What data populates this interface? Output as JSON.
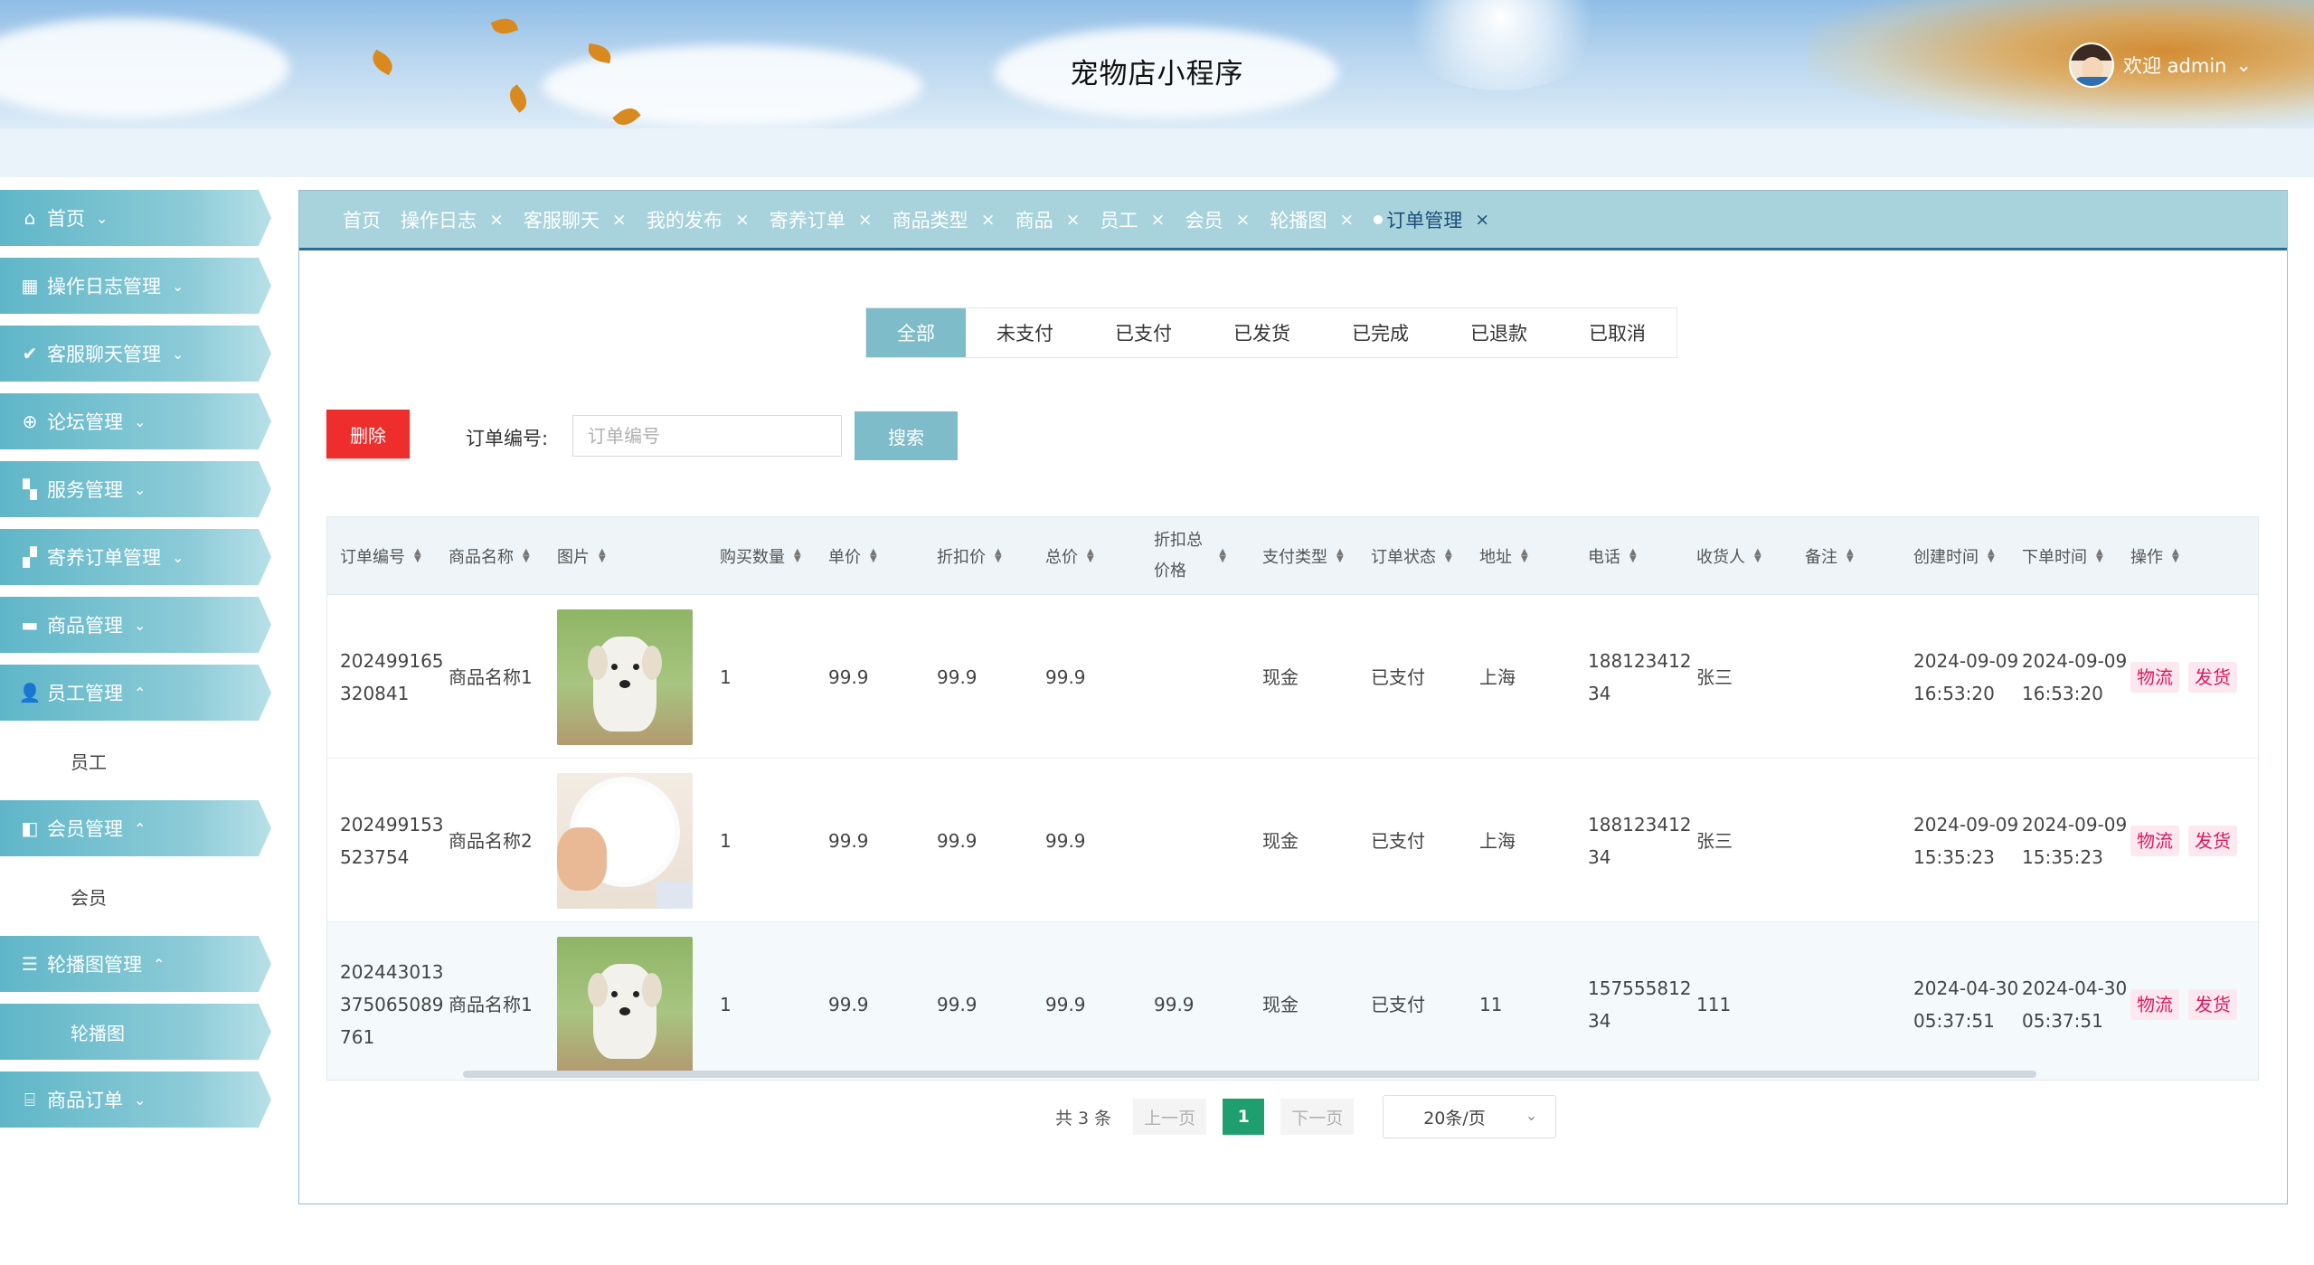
{
  "app": {
    "title": "宠物店小程序",
    "welcome": "欢迎 admin"
  },
  "sidebar": {
    "items": [
      {
        "label": "首页",
        "icon": "home-icon",
        "glyph": "⌂",
        "chev": "⌄"
      },
      {
        "label": "操作日志管理",
        "icon": "grid-icon",
        "glyph": "▦",
        "chev": "⌄"
      },
      {
        "label": "客服聊天管理",
        "icon": "check-icon",
        "glyph": "✔",
        "chev": "⌄"
      },
      {
        "label": "论坛管理",
        "icon": "plus-circle-icon",
        "glyph": "⊕",
        "chev": "⌄"
      },
      {
        "label": "服务管理",
        "icon": "tiles-icon",
        "glyph": "▚",
        "chev": "⌄"
      },
      {
        "label": "寄养订单管理",
        "icon": "blocks-icon",
        "glyph": "▞",
        "chev": "⌄"
      },
      {
        "label": "商品管理",
        "icon": "card-icon",
        "glyph": "▬",
        "chev": "⌄"
      },
      {
        "label": "员工管理",
        "icon": "user-icon",
        "glyph": "👤",
        "chev": "⌃",
        "sub": "员工"
      },
      {
        "label": "会员管理",
        "icon": "panel-icon",
        "glyph": "◧",
        "chev": "⌃",
        "sub": "会员"
      },
      {
        "label": "轮播图管理",
        "icon": "list-icon",
        "glyph": "☰",
        "chev": "⌃",
        "sub": "轮播图",
        "sub_active": true
      },
      {
        "label": "商品订单",
        "icon": "briefcase-icon",
        "glyph": "⌸",
        "chev": "⌄"
      }
    ]
  },
  "tabs": [
    "首页",
    "操作日志",
    "客服聊天",
    "我的发布",
    "寄养订单",
    "商品类型",
    "商品",
    "员工",
    "会员",
    "轮播图",
    "订单管理"
  ],
  "tab_close": "×",
  "status_tabs": [
    "全部",
    "未支付",
    "已支付",
    "已发货",
    "已完成",
    "已退款",
    "已取消"
  ],
  "toolbar": {
    "delete_label": "删除",
    "search_label": "订单编号:",
    "search_placeholder": "订单编号",
    "search_button": "搜索"
  },
  "table": {
    "columns": [
      "订单编号",
      "商品名称",
      "图片",
      "购买数量",
      "单价",
      "折扣价",
      "总价",
      "折扣总价格",
      "支付类型",
      "订单状态",
      "地址",
      "电话",
      "收货人",
      "备注",
      "创建时间",
      "下单时间",
      "操作"
    ],
    "rows": [
      {
        "order_no": "202499165320841",
        "name": "商品名称1",
        "image": "white-puppy-on-deck",
        "qty": "1",
        "price": "99.9",
        "discount": "99.9",
        "total": "99.9",
        "discount_total": "",
        "pay_type": "现金",
        "status": "已支付",
        "address": "上海",
        "phone": "18812341234",
        "receiver": "张三",
        "remark": "",
        "created": "2024-09-09 16:53:20",
        "ordered": "2024-09-09 16:53:20",
        "action1": "物流",
        "action2": "发货"
      },
      {
        "order_no": "202499153523754",
        "name": "商品名称2",
        "image": "fluffy-white-dog",
        "qty": "1",
        "price": "99.9",
        "discount": "99.9",
        "total": "99.9",
        "discount_total": "",
        "pay_type": "现金",
        "status": "已支付",
        "address": "上海",
        "phone": "18812341234",
        "receiver": "张三",
        "remark": "",
        "created": "2024-09-09 15:35:23",
        "ordered": "2024-09-09 15:35:23",
        "action1": "物流",
        "action2": "发货"
      },
      {
        "order_no": "202443013375065089761",
        "name": "商品名称1",
        "image": "white-puppy-on-deck",
        "qty": "1",
        "price": "99.9",
        "discount": "99.9",
        "total": "99.9",
        "discount_total": "99.9",
        "pay_type": "现金",
        "status": "已支付",
        "address": "11",
        "phone": "15755581234",
        "receiver": "111",
        "remark": "",
        "created": "2024-04-30 05:37:51",
        "ordered": "2024-04-30 05:37:51",
        "action1": "物流",
        "action2": "发货"
      }
    ]
  },
  "pager": {
    "total": "共 3 条",
    "prev": "上一页",
    "current": "1",
    "next": "下一页",
    "size": "20条/页"
  },
  "colors": {
    "accent": "#7fbcc9",
    "tabbar": "#a9d3dc",
    "danger": "#ee2d2d",
    "page_active": "#1f9e6f",
    "tag_text": "#d81b60"
  }
}
